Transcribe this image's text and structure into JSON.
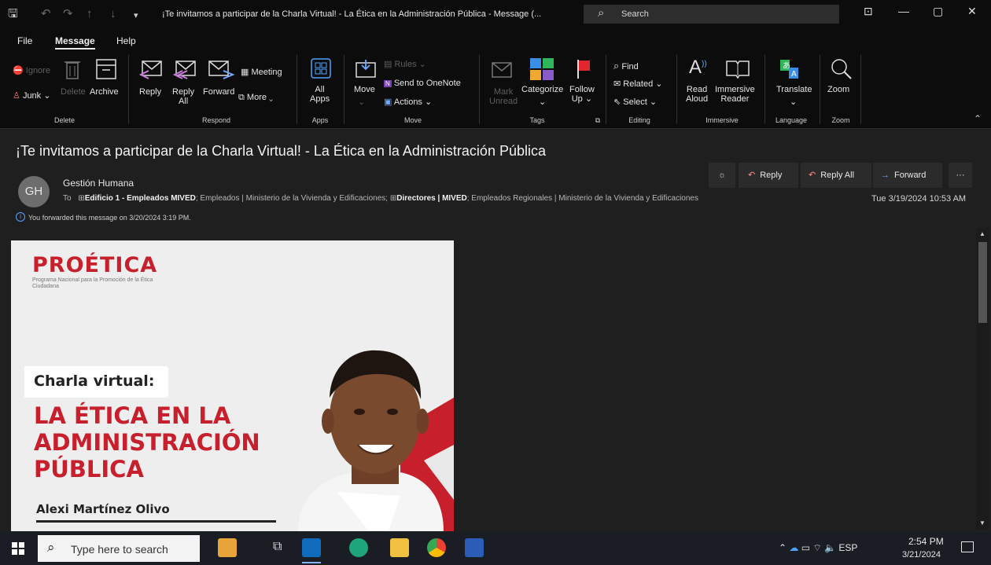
{
  "titlebar": {
    "title": "¡Te invitamos a participar de la Charla Virtual! - La Ética en la Administración Pública  -  Message (...",
    "search_placeholder": "Search",
    "quick_access": {
      "save": "🖫",
      "undo": "↶",
      "redo": "↷",
      "up": "↑",
      "down": "↓",
      "customize": "▾"
    }
  },
  "menu": {
    "file": "File",
    "message": "Message",
    "help": "Help"
  },
  "ribbon": {
    "delete": {
      "ignore": "Ignore",
      "junk": "Junk",
      "delete": "Delete",
      "archive": "Archive",
      "group": "Delete"
    },
    "respond": {
      "reply": "Reply",
      "reply_all_1": "Reply",
      "reply_all_2": "All",
      "forward": "Forward",
      "meeting": "Meeting",
      "more": "More",
      "group": "Respond"
    },
    "apps": {
      "label_1": "All",
      "label_2": "Apps",
      "group": "Apps"
    },
    "move": {
      "move": "Move",
      "rules": "Rules",
      "onenote": "Send to OneNote",
      "actions": "Actions",
      "group": "Move"
    },
    "tags": {
      "mark_1": "Mark",
      "mark_2": "Unread",
      "categorize": "Categorize",
      "follow_1": "Follow",
      "follow_2": "Up",
      "group": "Tags"
    },
    "editing": {
      "find": "Find",
      "related": "Related",
      "select": "Select",
      "group": "Editing"
    },
    "immersive": {
      "read_1": "Read",
      "read_2": "Aloud",
      "reader_1": "Immersive",
      "reader_2": "Reader",
      "group": "Immersive"
    },
    "language": {
      "translate": "Translate",
      "group": "Language"
    },
    "zoom": {
      "zoom": "Zoom",
      "group": "Zoom"
    }
  },
  "message": {
    "subject": "¡Te invitamos a participar de la Charla Virtual! - La Ética en la Administración Pública",
    "avatar_initials": "GH",
    "sender": "Gestión Humana",
    "to_label": "To",
    "to_group1": "Edificio 1 - Empleados MIVED",
    "to_mid": "; Empleados | Ministerio de la Vivienda y Edificaciones; ",
    "to_group2": "Directores | MIVED",
    "to_end": "; Empleados Regionales | Ministerio de la Vivienda y Edificaciones",
    "date": "Tue 3/19/2024 10:53 AM",
    "forward_note": "You forwarded this message on 3/20/2024 3:19 PM.",
    "actions": {
      "reply": "Reply",
      "reply_all": "Reply All",
      "forward": "Forward",
      "more": "···"
    }
  },
  "flyer": {
    "logo": "PROÉTICA",
    "logo_sub": "Programa Nacional para la Promoción de la Ética Ciudadana",
    "tag": "Charla virtual:",
    "headline": [
      "LA ÉTICA EN LA",
      "ADMINISTRACIÓN",
      "PÚBLICA"
    ],
    "speaker": "Alexi Martínez Olivo"
  },
  "taskbar": {
    "search_placeholder": "Type here to search",
    "language": "ESP",
    "time": "2:54 PM",
    "date": "3/21/2024"
  },
  "colors": {
    "accent_red": "#c7202c",
    "link_blue": "#5aa0ff"
  }
}
